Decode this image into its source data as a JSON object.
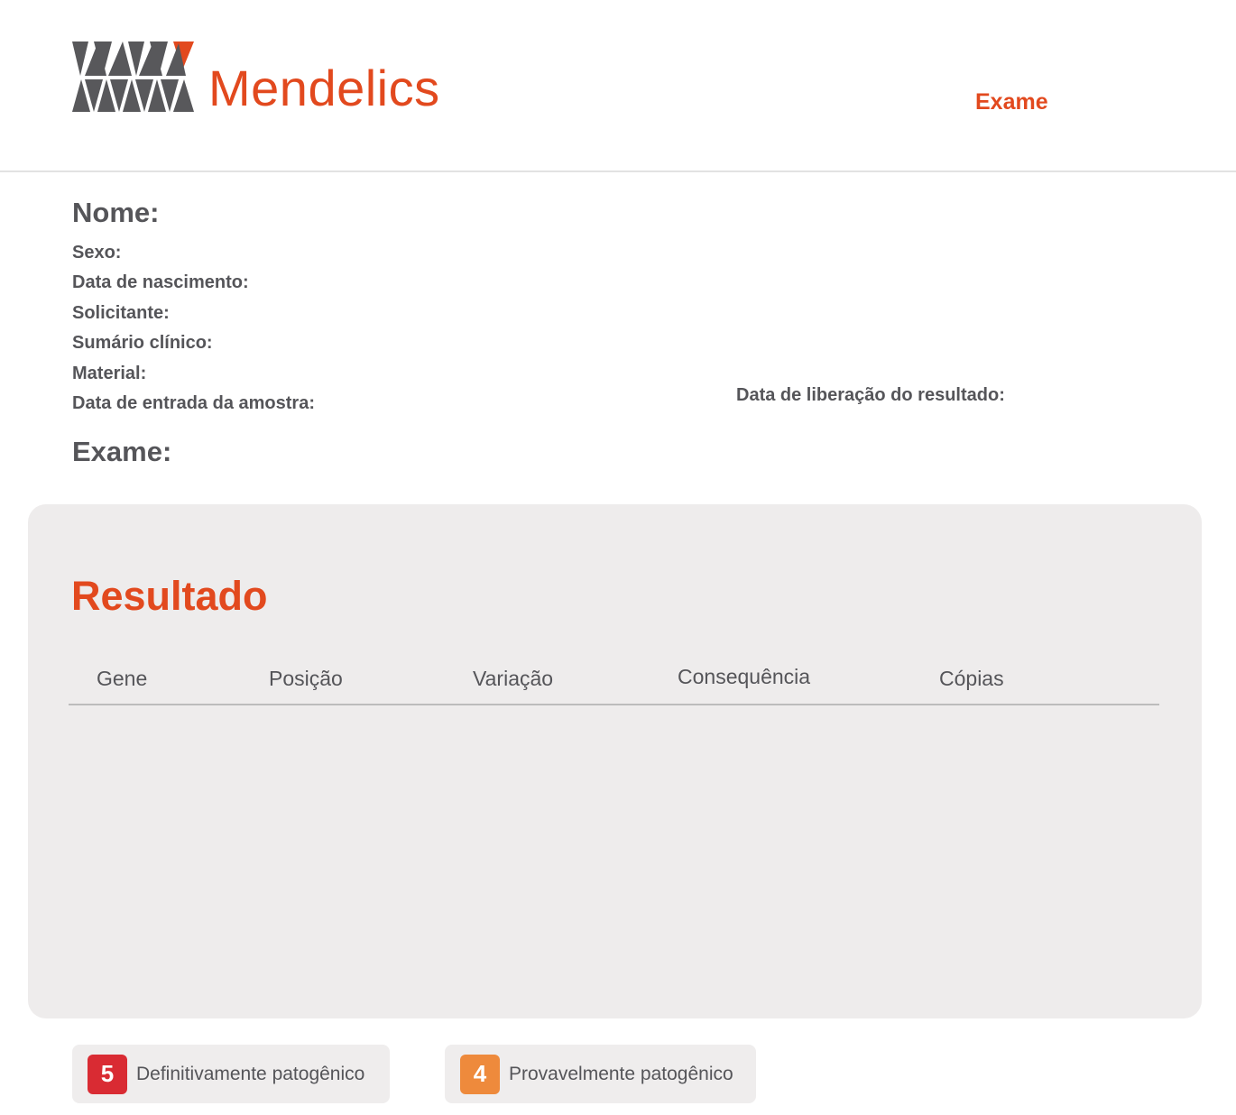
{
  "header": {
    "brand": "Mendelics",
    "exam_link": "Exame"
  },
  "patient": {
    "name_label": "Nome:",
    "sex_label": "Sexo:",
    "birth_label": "Data de nascimento:",
    "requester_label": "Solicitante:",
    "clinical_label": "Sumário clínico:",
    "material_label": "Material:",
    "entry_label": "Data de entrada da amostra:",
    "release_label": "Data de liberação do resultado:",
    "exam_label": "Exame:"
  },
  "result": {
    "title": "Resultado",
    "columns": [
      "Gene",
      "Posição",
      "Variação",
      "Consequência",
      "Cópias"
    ]
  },
  "legend": [
    {
      "badge": "5",
      "label": "Definitivamente patogênico",
      "color": "#d92b33"
    },
    {
      "badge": "4",
      "label": "Provavelmente patogênico",
      "color": "#ee8a3c"
    }
  ],
  "colors": {
    "accent": "#e2491e",
    "logo_gray": "#58585b",
    "panel": "#eeecec"
  }
}
